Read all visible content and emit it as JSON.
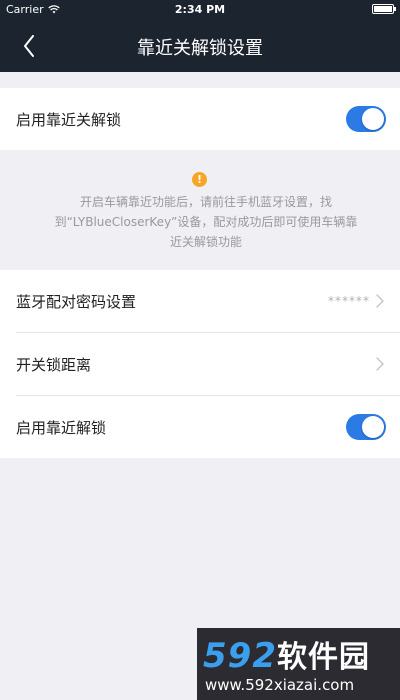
{
  "status_bar": {
    "carrier": "Carrier",
    "time": "2:34 PM"
  },
  "nav": {
    "title": "靠近关解锁设置",
    "back_icon": "chevron-left-icon"
  },
  "top_setting": {
    "label": "启用靠近关解锁",
    "enabled": true
  },
  "info": {
    "icon": "info-icon",
    "icon_glyph": "!",
    "text": "开启车辆靠近功能后，请前往手机蓝牙设置，找到“LYBlueCloserKey”设备，配对成功后即可使用车辆靠近关解锁功能"
  },
  "settings": [
    {
      "label": "蓝牙配对密码设置",
      "value": "******"
    },
    {
      "label": "开关锁距离",
      "value": ""
    },
    {
      "label": "启用靠近解锁",
      "enabled": true
    }
  ],
  "watermark": {
    "brand_num": "592",
    "brand_cn": "软件园",
    "url": "www.592xiazai.com"
  },
  "colors": {
    "nav_bg": "#1c2430",
    "toggle_on": "#2c7be5",
    "info_icon": "#f5a623",
    "page_bg": "#efeff4"
  }
}
